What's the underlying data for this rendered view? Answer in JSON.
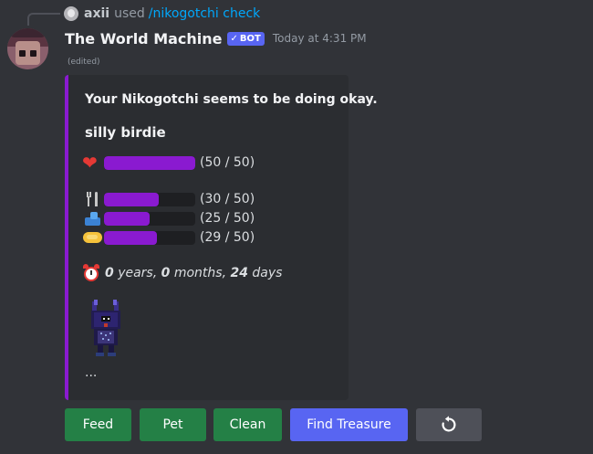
{
  "interaction": {
    "user": "axii",
    "used_text": "used",
    "command": "/nikogotchi check"
  },
  "message": {
    "author": "The World Machine",
    "bot_tag": "BOT",
    "timestamp": "Today at 4:31 PM",
    "edited": "(edited)"
  },
  "embed": {
    "accent_color": "#8a1ad0",
    "description": "Your Nikogotchi seems to be doing okay.",
    "name": "silly birdie",
    "stats": [
      {
        "icon": "heart-icon",
        "current": 50,
        "max": 50,
        "text": "(50 / 50)"
      },
      {
        "icon": "fork-and-knife-icon",
        "current": 30,
        "max": 50,
        "text": "(30 / 50)"
      },
      {
        "icon": "bath-icon",
        "current": 25,
        "max": 50,
        "text": "(25 / 50)"
      },
      {
        "icon": "soap-icon",
        "current": 29,
        "max": 50,
        "text": "(29 / 50)"
      }
    ],
    "age": {
      "years": "0",
      "years_label": "years,",
      "months": "0",
      "months_label": "months,",
      "days": "24",
      "days_label": "days"
    },
    "footer": "..."
  },
  "buttons": {
    "feed": "Feed",
    "pet": "Pet",
    "clean": "Clean",
    "find_treasure": "Find Treasure",
    "refresh_icon": "refresh-icon"
  },
  "colors": {
    "success": "#248046",
    "primary": "#5865f2",
    "secondary": "#4e5058"
  }
}
